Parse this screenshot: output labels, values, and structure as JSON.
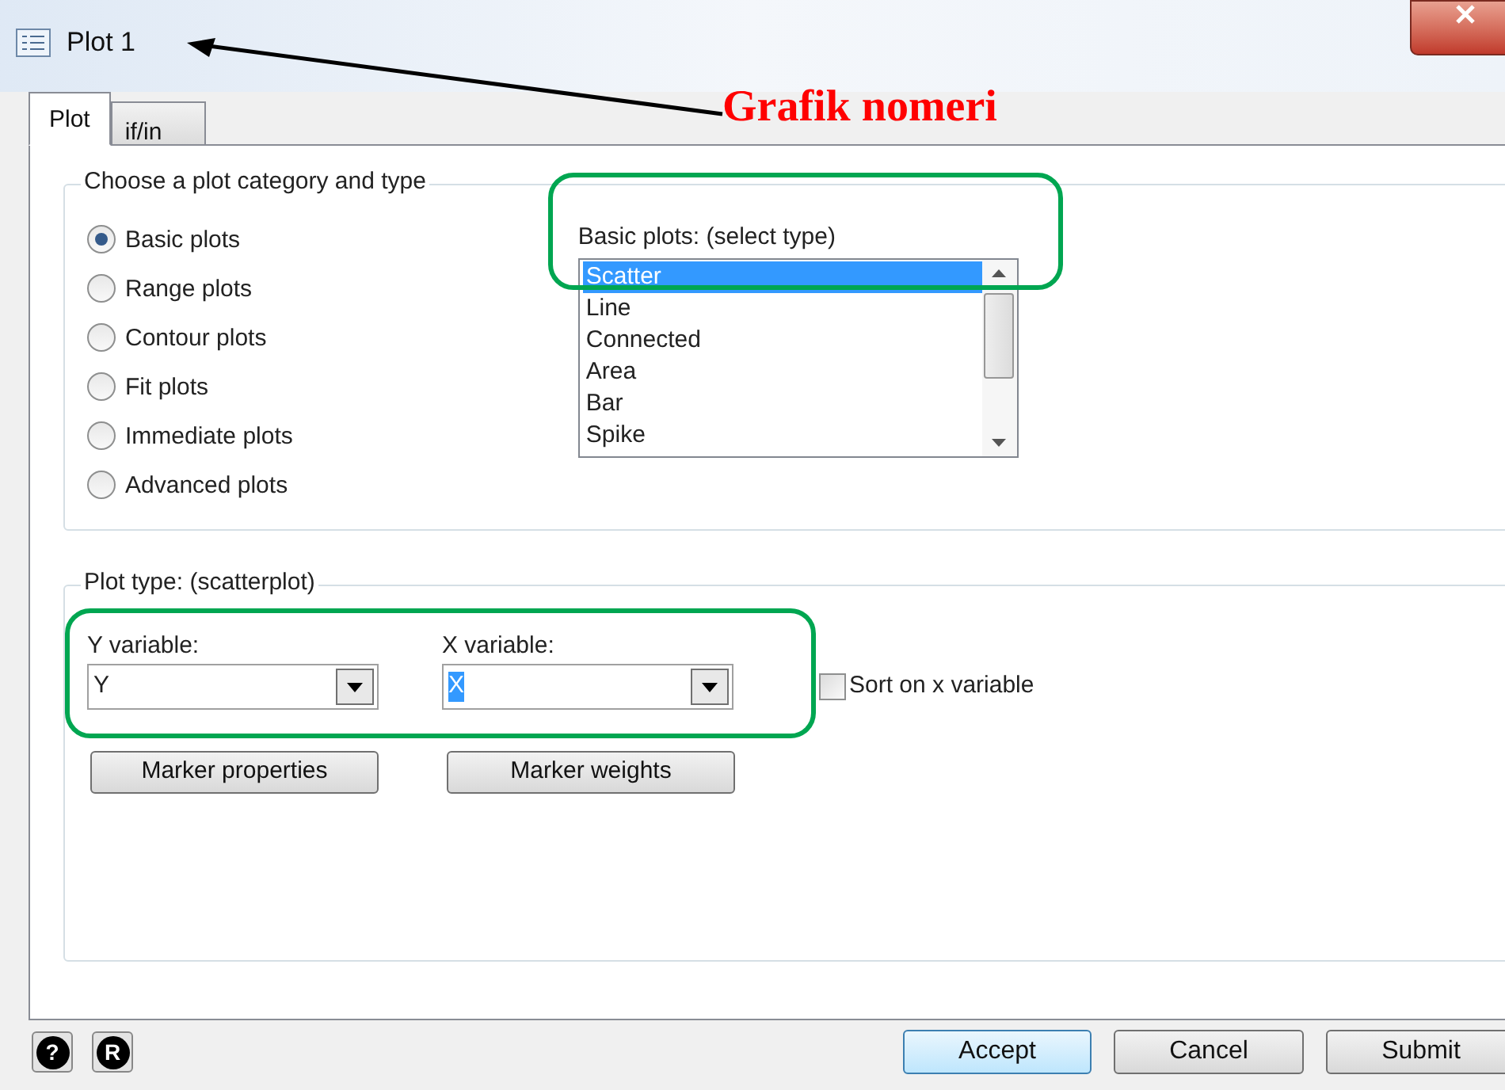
{
  "window": {
    "title": "Plot 1"
  },
  "tabs": [
    {
      "label": "Plot",
      "selected": true
    },
    {
      "label": "if/in",
      "selected": false
    }
  ],
  "category_group": {
    "title": "Choose a plot category and type",
    "options": [
      {
        "label": "Basic plots",
        "selected": true
      },
      {
        "label": "Range plots",
        "selected": false
      },
      {
        "label": "Contour plots",
        "selected": false
      },
      {
        "label": "Fit plots",
        "selected": false
      },
      {
        "label": "Immediate plots",
        "selected": false
      },
      {
        "label": "Advanced plots",
        "selected": false
      }
    ]
  },
  "type_list": {
    "label": "Basic plots: (select type)",
    "items": [
      {
        "label": "Scatter",
        "selected": true
      },
      {
        "label": "Line",
        "selected": false
      },
      {
        "label": "Connected",
        "selected": false
      },
      {
        "label": "Area",
        "selected": false
      },
      {
        "label": "Bar",
        "selected": false
      },
      {
        "label": "Spike",
        "selected": false
      }
    ]
  },
  "plot_type_group": {
    "title": "Plot type: (scatterplot)",
    "y_variable": {
      "label": "Y variable:",
      "value": "Y",
      "highlighted": false
    },
    "x_variable": {
      "label": "X variable:",
      "value": "X",
      "highlighted": true
    },
    "sort": {
      "label": "Sort on x variable",
      "checked": false
    },
    "buttons": [
      "Marker properties",
      "Marker weights"
    ]
  },
  "footer": {
    "icon_buttons": [
      "?",
      "R"
    ],
    "buttons": [
      {
        "label": "Accept",
        "default": true
      },
      {
        "label": "Cancel",
        "default": false
      },
      {
        "label": "Submit",
        "default": false
      }
    ]
  },
  "annotation": {
    "label": "Grafik nomeri"
  }
}
